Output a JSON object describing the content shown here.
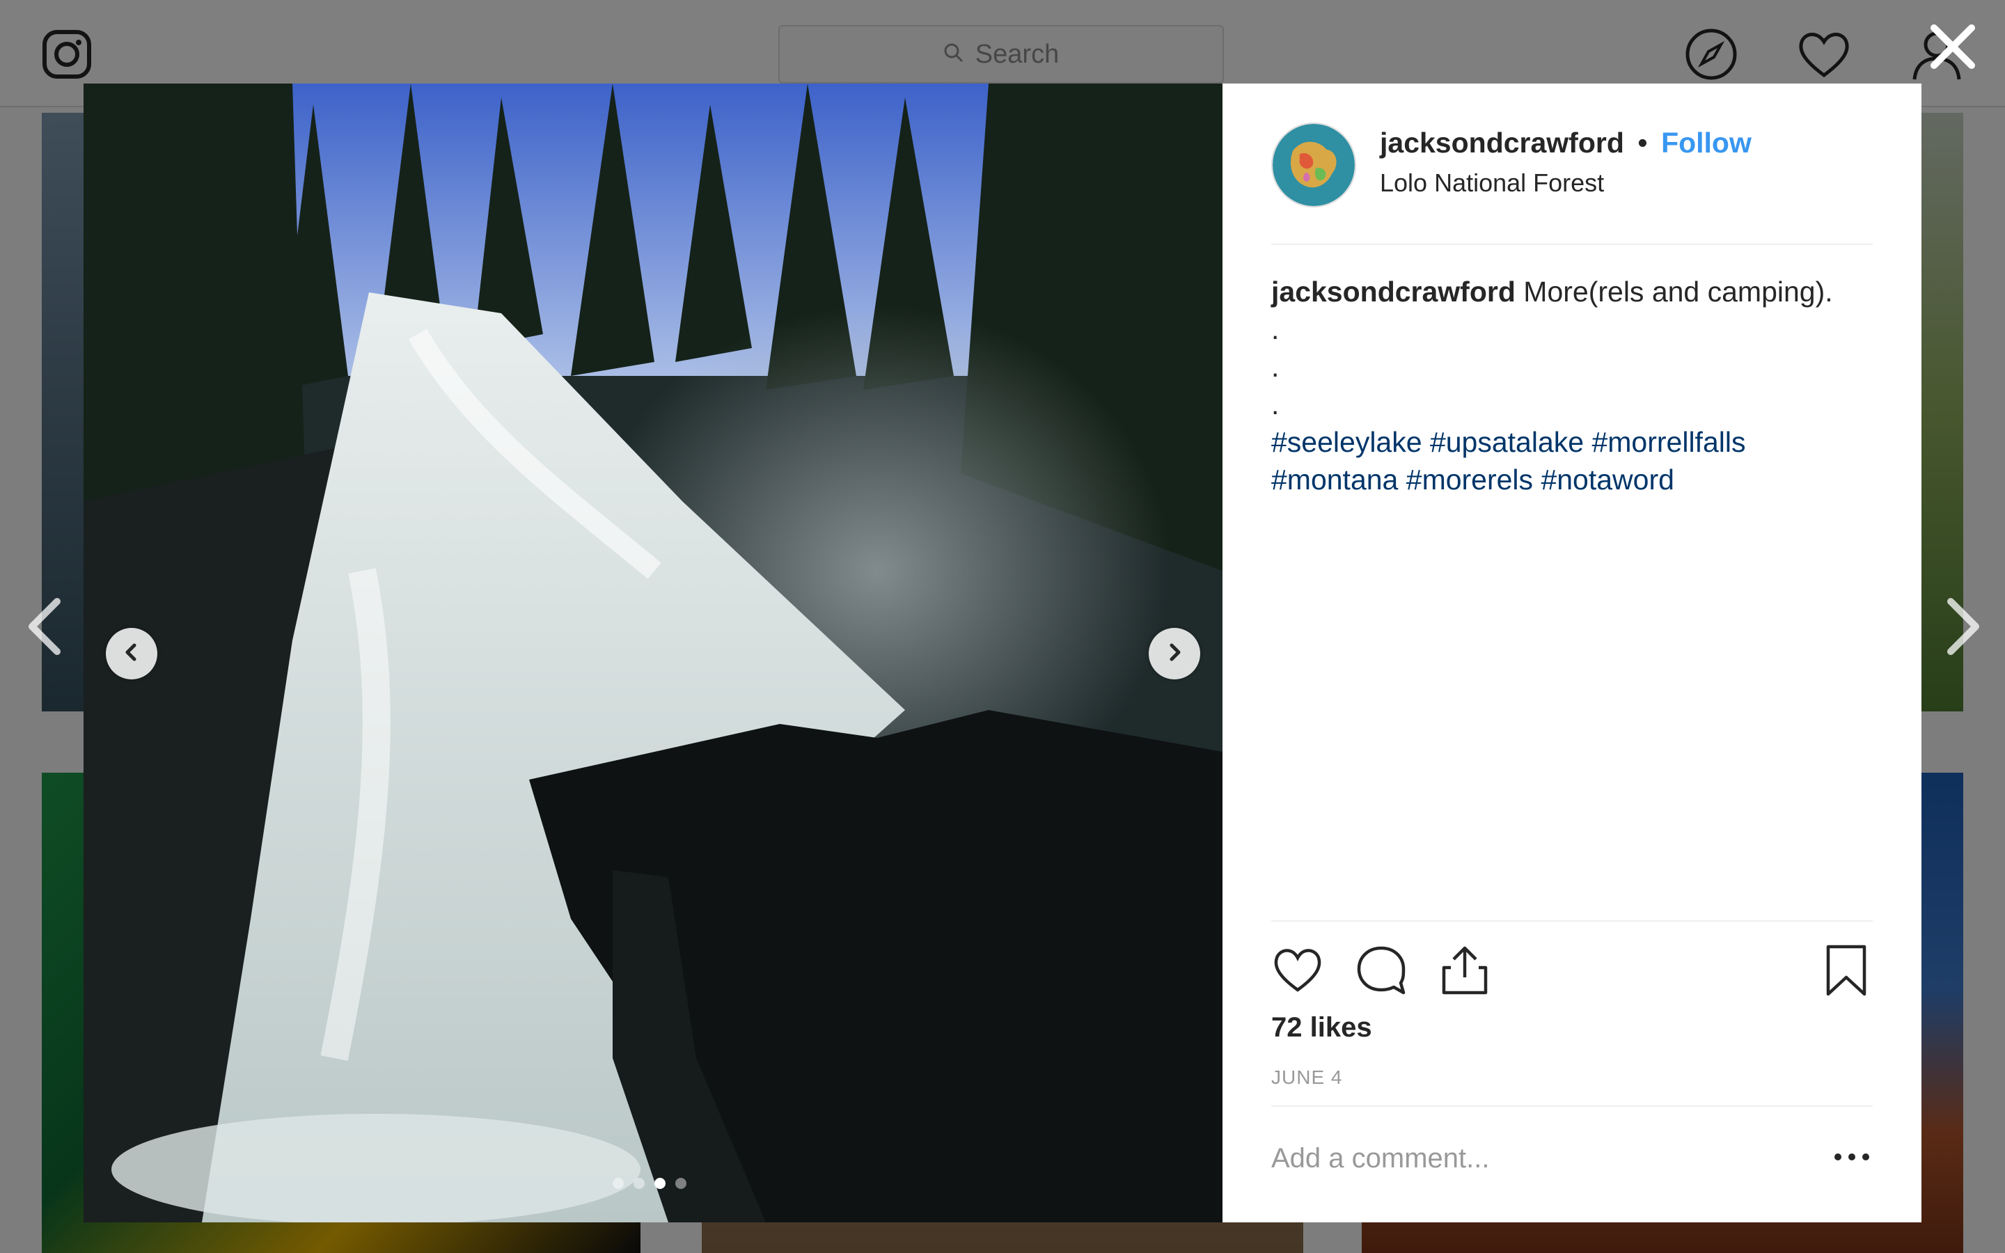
{
  "nav": {
    "search_placeholder": "Search",
    "icons": [
      "instagram-logo-icon",
      "search-icon",
      "compass-icon",
      "heart-icon",
      "profile-icon"
    ]
  },
  "post": {
    "username": "jacksondcrawford",
    "separator": "•",
    "follow_label": "Follow",
    "location": "Lolo National Forest",
    "caption": {
      "username": "jacksondcrawford",
      "text": "More(rels and camping).",
      "dot_lines": [
        ".",
        ".",
        "."
      ],
      "hashtags_line1": [
        "#seeleylake",
        "#upsatalake",
        "#morrellfalls"
      ],
      "hashtags_line2": [
        "#montana",
        "#morerels",
        "#notaword"
      ]
    },
    "likes": "72 likes",
    "date": "JUNE 4",
    "comment_placeholder": "Add a comment...",
    "carousel": {
      "total": 4,
      "active_index": 2
    }
  },
  "colors": {
    "follow": "#3897f0",
    "hashtag": "#003569",
    "overlay": "rgba(0,0,0,0.5)"
  }
}
